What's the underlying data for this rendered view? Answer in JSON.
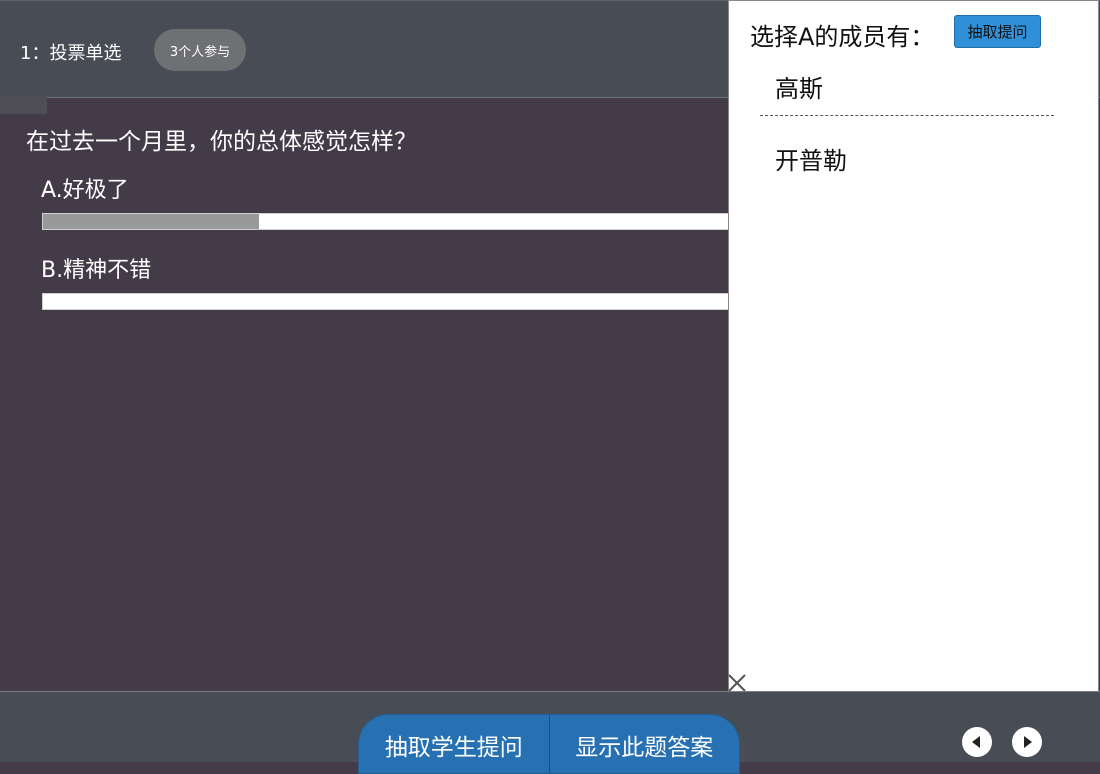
{
  "header": {
    "question_title": "1：投票单选",
    "participants_badge": "3个人参与"
  },
  "question": {
    "text": "在过去一个月里，你的总体感觉怎样？",
    "options": [
      {
        "label": "A.好极了",
        "fraction": 0.31
      },
      {
        "label": "B.精神不错",
        "fraction": 0
      }
    ]
  },
  "side_panel": {
    "heading": "选择A的成员有：",
    "pick_button": "抽取提问",
    "members": [
      "高斯",
      "开普勒"
    ]
  },
  "bottom_bar": {
    "pick_student_button": "抽取学生提问",
    "show_answer_button": "显示此题答案"
  },
  "icons": {
    "close": "close-icon",
    "prev": "chevron-left-icon",
    "next": "chevron-right-icon"
  },
  "colors": {
    "background": "#433c48",
    "header": "#474c55",
    "accent_blue": "#2771b3",
    "panel_button": "#2f90d8",
    "bar_fill": "#999999"
  }
}
